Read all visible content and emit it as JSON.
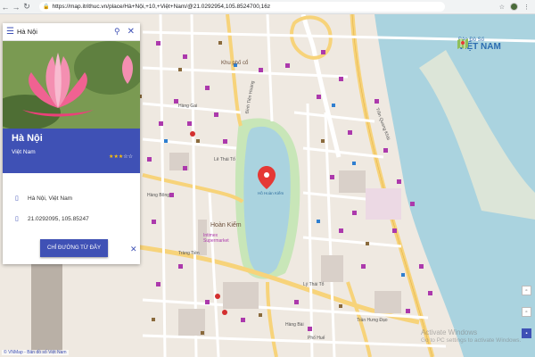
{
  "browser": {
    "url": "https://map.itrithuc.vn/place/Hà+Nội,+10,+Việt+Nam/@21.0292954,105.8524700,16z"
  },
  "search": {
    "value": "Hà Nội"
  },
  "place": {
    "name": "Hà Nội",
    "subtitle": "Việt Nam",
    "rating": 3,
    "rating_max": 5,
    "address": "Hà Nội, Việt Nam",
    "coordinates": "21.0292095, 105.85247",
    "directions_label": "CHỈ ĐƯỜNG TỪ ĐÂY"
  },
  "brand": {
    "line1": "Bản Đồ Số",
    "line2": "VIỆT NAM"
  },
  "map": {
    "labels": {
      "district": "Hoàn Kiếm",
      "supermarket": "Intimex Supermarket",
      "khu_pho_co": "Khu phố cổ",
      "lake": "Hồ Hoàn Kiếm"
    },
    "streets": [
      "Hàng Bài",
      "Tràng Tiền",
      "Đinh Tiên Hoàng",
      "Hàng Gai",
      "Lý Thái Tổ",
      "Hàng Bông",
      "Trần Hưng Đạo",
      "Phố Huế",
      "Lê Thái Tổ",
      "Trần Quang Khải"
    ],
    "marker_color": "#e53935",
    "water_color": "#aad3df",
    "road_color": "#f7d37a",
    "accent": "#3f51b5"
  },
  "attribution": "© VNMap - Bản đồ số Việt Nam",
  "watermark": {
    "line1": "Activate Windows",
    "line2": "Go to PC settings to activate Windows."
  },
  "controls": [
    "zoom-in",
    "zoom-out",
    "layers"
  ]
}
